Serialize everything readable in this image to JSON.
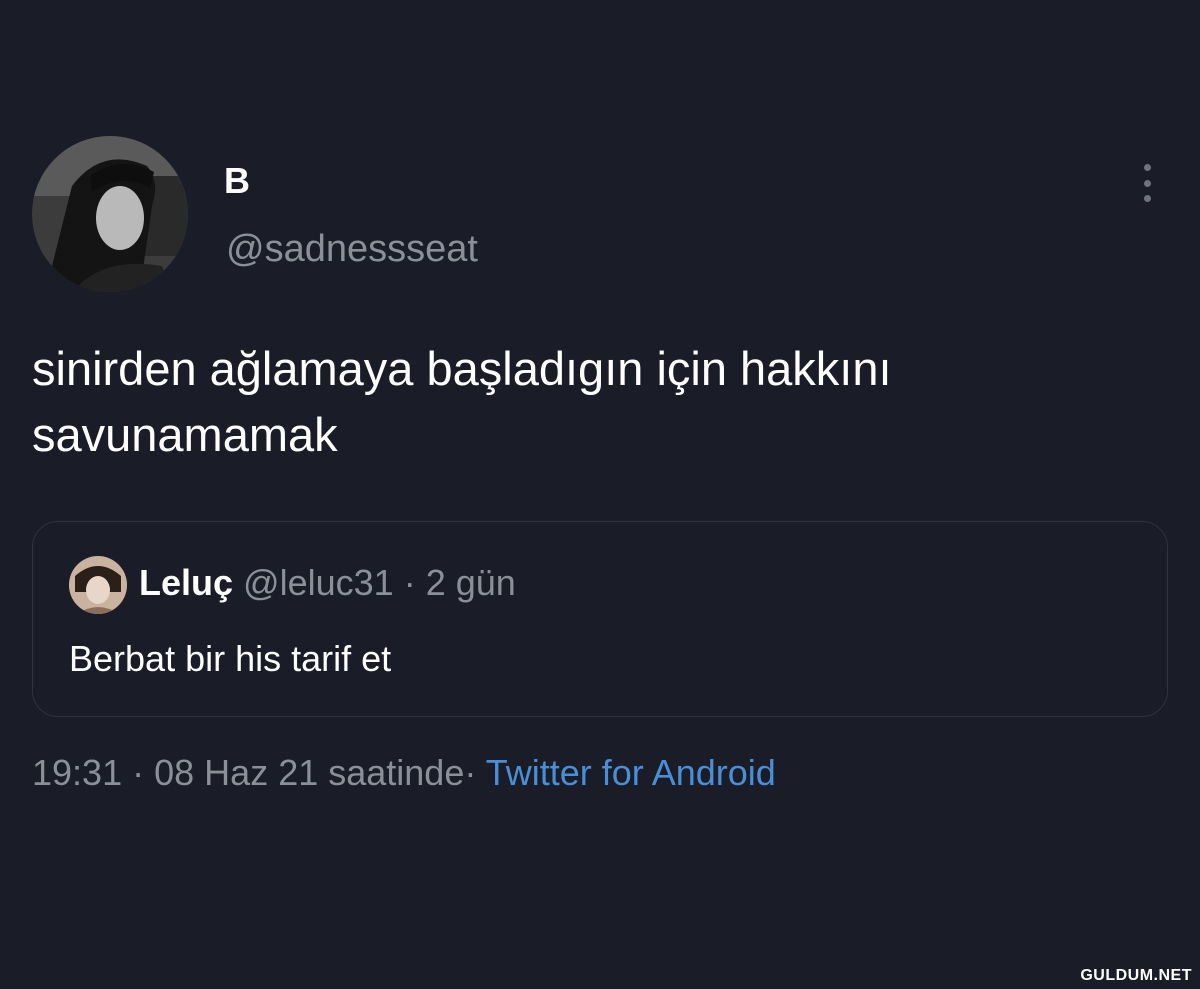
{
  "tweet": {
    "display_name": "B",
    "handle": "@sadnessseat",
    "text": "sinirden ağlamaya başladıgın için hakkını savunamamak",
    "more_icon": "more-vertical-icon"
  },
  "quoted_tweet": {
    "display_name": "Leluç",
    "handle": "@leluc31",
    "separator": "·",
    "age": "2 gün",
    "text": "Berbat bir his tarif et"
  },
  "meta": {
    "time": "19:31",
    "separator": "·",
    "date_text": "08 Haz 21 saatinde",
    "source": "Twitter for Android"
  },
  "watermark": "GULDUM.NET",
  "colors": {
    "background": "#1a1c27",
    "text_primary": "#ffffff",
    "text_secondary": "#8a8f98",
    "link": "#4a8fd6",
    "border": "#2f333d"
  }
}
